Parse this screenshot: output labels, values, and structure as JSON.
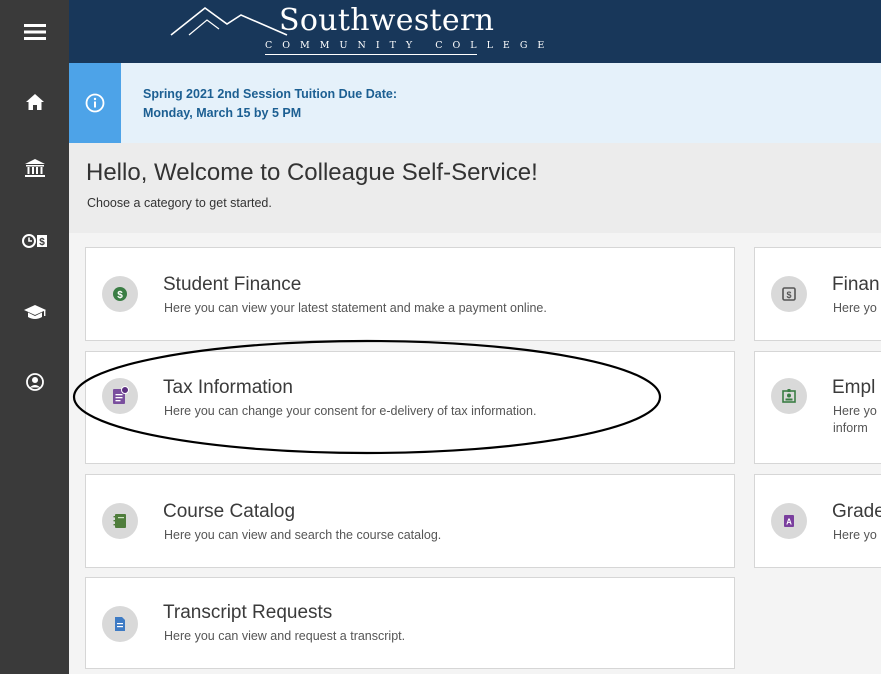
{
  "header": {
    "logo_name": "Southwestern",
    "logo_sub": "COMMUNITY COLLEGE"
  },
  "sidebar": {
    "items": [
      {
        "icon": "menu-icon"
      },
      {
        "icon": "home-icon"
      },
      {
        "icon": "bank-icon"
      },
      {
        "icon": "time-money-icon"
      },
      {
        "icon": "graduation-cap-icon"
      },
      {
        "icon": "user-circle-icon"
      }
    ]
  },
  "alert": {
    "line1": "Spring 2021 2nd Session Tuition Due Date:",
    "line2": "Monday, March 15 by 5 PM"
  },
  "welcome": {
    "title": "Hello, Welcome to Colleague Self-Service!",
    "subtitle": "Choose a category to get started."
  },
  "cards_left": [
    {
      "title": "Student Finance",
      "desc": "Here you can view your latest statement and make a payment online.",
      "icon": "dollar-coin-icon",
      "icon_color": "#3a7d44"
    },
    {
      "title": "Tax Information",
      "desc": "Here you can change your consent for e-delivery of tax information.",
      "icon": "tax-document-icon",
      "icon_color": "#7a4f9e"
    },
    {
      "title": "Course Catalog",
      "desc": "Here you can view and search the course catalog.",
      "icon": "catalog-book-icon",
      "icon_color": "#4f7d3c"
    },
    {
      "title": "Transcript Requests",
      "desc": "Here you can view and request a transcript.",
      "icon": "transcript-icon",
      "icon_color": "#3e7bc4"
    }
  ],
  "cards_right": [
    {
      "title": "Finan",
      "desc1": "Here yo",
      "desc2": "",
      "icon": "financial-aid-icon",
      "icon_color": "#555555"
    },
    {
      "title": "Empl",
      "desc1": "Here yo",
      "desc2": "inform",
      "icon": "employee-badge-icon",
      "icon_color": "#3a7d44"
    },
    {
      "title": "Grade",
      "desc1": "Here yo",
      "desc2": "",
      "icon": "grades-icon",
      "icon_color": "#7a3f9e"
    }
  ],
  "colors": {
    "header_bg": "#18375a",
    "sidebar_bg": "#3a3a3a",
    "alert_accent": "#4da3e8",
    "alert_bg": "#e5f1fa"
  }
}
